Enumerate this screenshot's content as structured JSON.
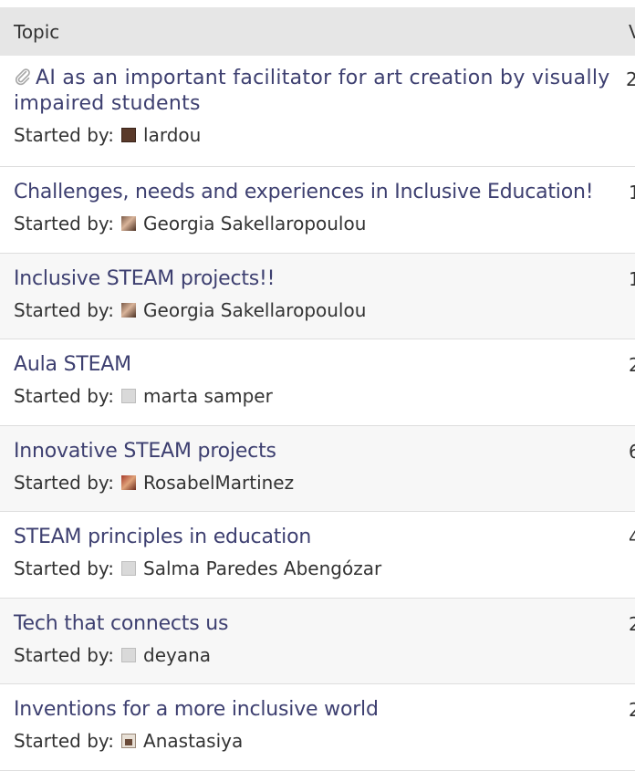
{
  "table": {
    "header": {
      "topic": "Topic",
      "col2": "V"
    },
    "started_by_label": "Started by:",
    "rows": [
      {
        "title": "AI as an important facilitator for art creation by visually impaired students",
        "author": "lardou",
        "count": "2",
        "has_attachment": true,
        "avatar": "dark"
      },
      {
        "title": "Challenges, needs and experiences in Inclusive Education!",
        "author": "Georgia Sakellaropoulou",
        "count": "1",
        "avatar": "photo"
      },
      {
        "title": "Inclusive STEAM projects!!",
        "author": "Georgia Sakellaropoulou",
        "count": "1",
        "avatar": "photo"
      },
      {
        "title": "Aula STEAM",
        "author": "marta samper",
        "count": "2",
        "avatar": "default"
      },
      {
        "title": "Innovative STEAM projects",
        "author": "RosabelMartinez",
        "count": "6",
        "avatar": "photo-red"
      },
      {
        "title": "STEAM principles in education",
        "author": "Salma Paredes Abengózar",
        "count": "4",
        "avatar": "default"
      },
      {
        "title": "Tech that connects us",
        "author": "deyana",
        "count": "2",
        "avatar": "default"
      },
      {
        "title": "Inventions for a more inclusive world",
        "author": "Anastasiya",
        "count": "2",
        "avatar": "house"
      }
    ]
  },
  "colors": {
    "link": "#3d3f70",
    "header_bg": "#e6e6e6",
    "alt_row_bg": "#f7f7f7"
  }
}
